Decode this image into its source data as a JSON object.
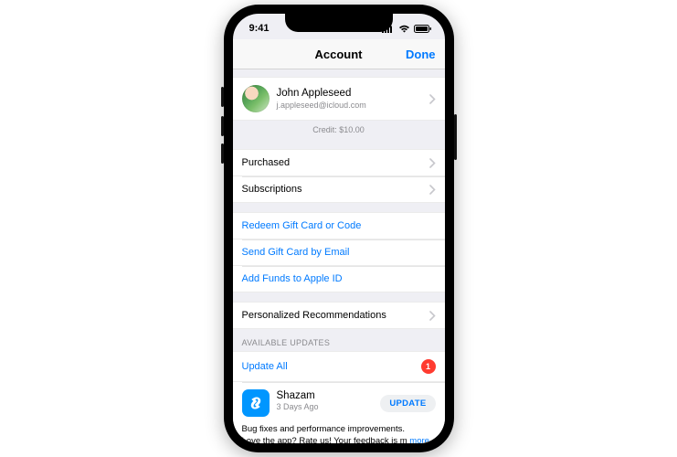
{
  "status": {
    "time": "9:41"
  },
  "nav": {
    "title": "Account",
    "done": "Done"
  },
  "profile": {
    "name": "John Appleseed",
    "email": "j.appleseed@icloud.com",
    "credit": "Credit: $10.00"
  },
  "rows": {
    "purchased": "Purchased",
    "subscriptions": "Subscriptions",
    "redeem": "Redeem Gift Card or Code",
    "sendGift": "Send Gift Card by Email",
    "addFunds": "Add Funds to Apple ID",
    "personalized": "Personalized Recommendations"
  },
  "updates": {
    "header": "AVAILABLE UPDATES",
    "updateAll": "Update All",
    "count": "1"
  },
  "app": {
    "name": "Shazam",
    "date": "3 Days Ago",
    "button": "UPDATE",
    "notes": "Bug fixes and performance improvements.\nLove the app? Rate us! Your feedback is m",
    "more": "more"
  }
}
